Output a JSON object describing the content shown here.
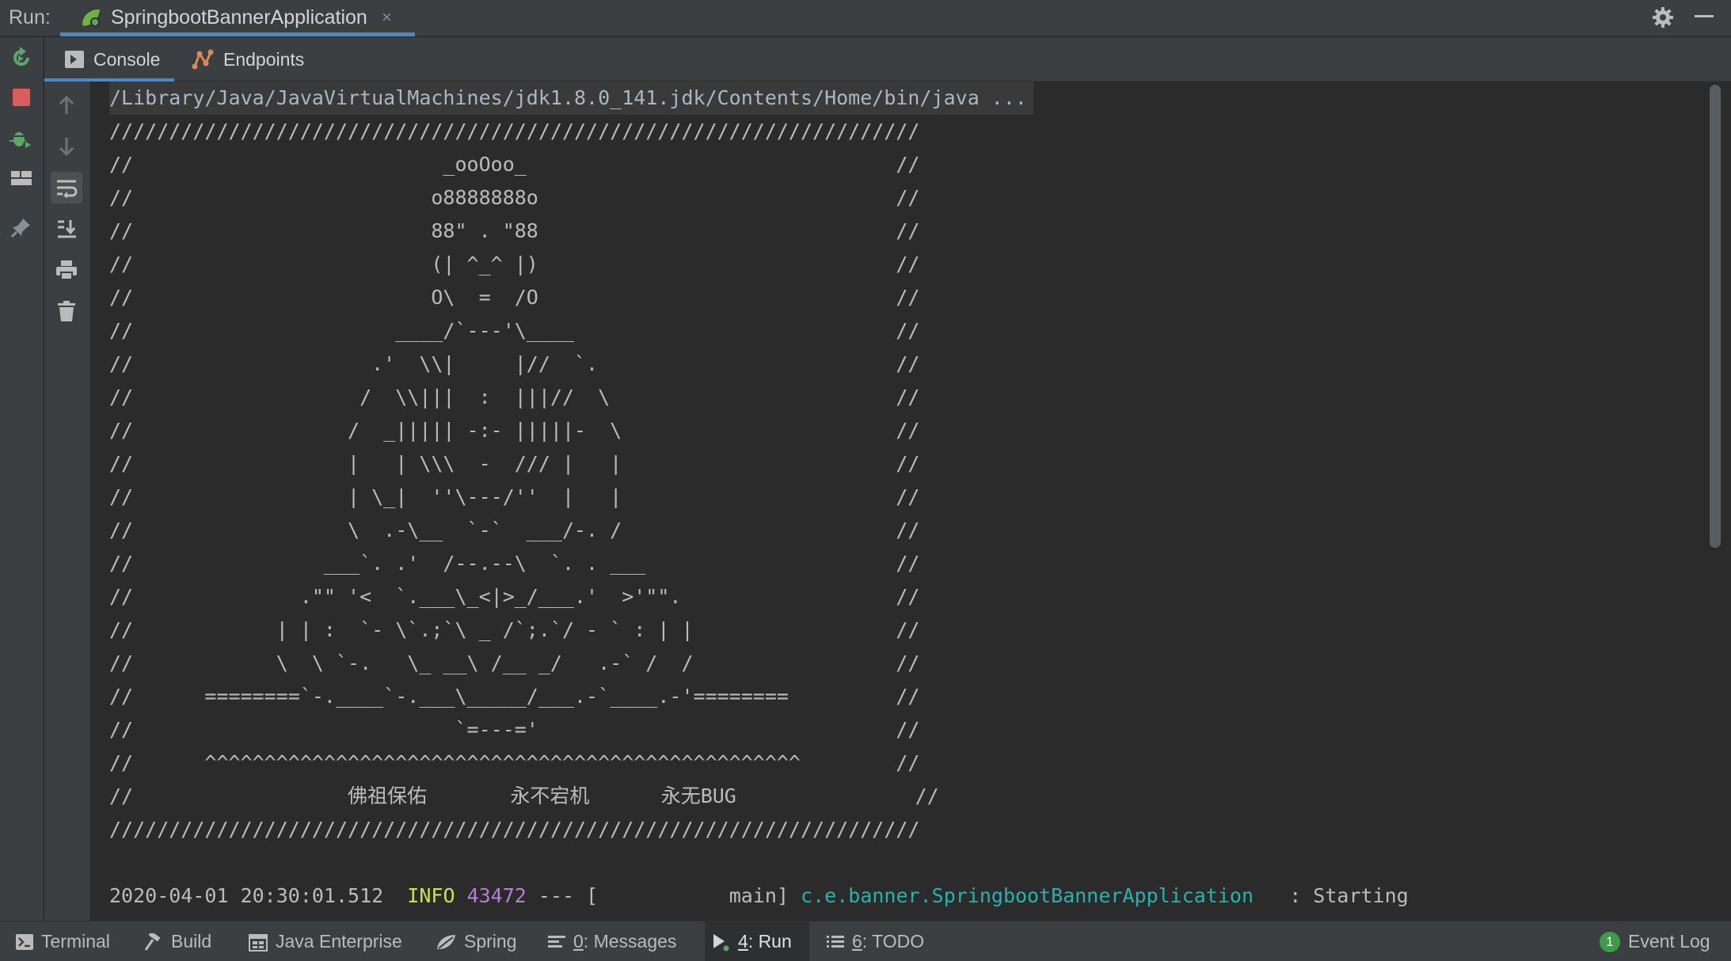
{
  "run_bar": {
    "label": "Run:",
    "tab_title": "SpringbootBannerApplication",
    "tab_close": "×"
  },
  "subtabs": [
    {
      "label": "Console",
      "active": true
    },
    {
      "label": "Endpoints",
      "active": false
    }
  ],
  "console": {
    "command": "/Library/Java/JavaVirtualMachines/jdk1.8.0_141.jdk/Contents/Home/bin/java ...",
    "banner": [
      "////////////////////////////////////////////////////////////////////",
      "//                          _ooOoo_                               //",
      "//                         o8888888o                              //",
      "//                         88\" . \"88                              //",
      "//                         (| ^_^ |)                              //",
      "//                         O\\  =  /O                              //",
      "//                      ____/`---'\\____                           //",
      "//                    .'  \\\\|     |//  `.                         //",
      "//                   /  \\\\|||  :  |||//  \\                        //",
      "//                  /  _||||| -:- |||||-  \\                       //",
      "//                  |   | \\\\\\  -  /// |   |                       //",
      "//                  | \\_|  ''\\---/''  |   |                       //",
      "//                  \\  .-\\__  `-`  ___/-. /                       //",
      "//                ___`. .'  /--.--\\  `. . ___                     //",
      "//              .\"\" '<  `.___\\_<|>_/___.'  >'\"\".                  //",
      "//            | | :  `- \\`.;`\\ _ /`;.`/ - ` : | |                 //",
      "//            \\  \\ `-.   \\_ __\\ /__ _/   .-` /  /                 //",
      "//      ========`-.____`-.___\\_____/___.-`____.-'========         //",
      "//                           `=---='                              //",
      "//      ^^^^^^^^^^^^^^^^^^^^^^^^^^^^^^^^^^^^^^^^^^^^^^^^^^        //",
      "//                  佛祖保佑       永不宕机      永无BUG               //",
      "////////////////////////////////////////////////////////////////////"
    ],
    "log": {
      "timestamp": "2020-04-01 20:30:01.512",
      "level": "INFO",
      "pid": "43472",
      "separator": "--- [",
      "thread": "main]",
      "logger": "c.e.banner.SpringbootBannerApplication",
      "message": ": Starting"
    }
  },
  "left_toolbar": [
    {
      "icon": "rerun-icon",
      "color": "#59a869"
    },
    {
      "icon": "stop-icon",
      "color": "#db5c5c"
    },
    {
      "icon": "debug-restart-icon",
      "color": "#59a869"
    },
    {
      "icon": "layout-icon"
    },
    {
      "icon": "pin-icon"
    }
  ],
  "console_toolbar": [
    {
      "icon": "scroll-up-icon"
    },
    {
      "icon": "scroll-down-icon"
    },
    {
      "icon": "soft-wrap-icon",
      "selected": true
    },
    {
      "icon": "scroll-to-end-icon"
    },
    {
      "icon": "print-icon"
    },
    {
      "icon": "clear-icon"
    }
  ],
  "bottom_tabs": [
    {
      "label": "Terminal",
      "icon": "terminal-icon"
    },
    {
      "label": "Build",
      "icon": "hammer-icon"
    },
    {
      "label": "Java Enterprise",
      "icon": "java-enterprise-icon"
    },
    {
      "label": "Spring",
      "icon": "spring-icon"
    },
    {
      "prefix": "0",
      "label": ": Messages",
      "icon": "messages-icon"
    },
    {
      "prefix": "4",
      "label": ": Run",
      "icon": "run-icon",
      "active": true
    },
    {
      "prefix": "6",
      "label": ": TODO",
      "icon": "todo-icon"
    }
  ],
  "event_log": {
    "label": "Event Log",
    "count": "1"
  },
  "colors": {
    "panel": "#3c3f41",
    "editor": "#2b2b2b",
    "accent": "#4a88c7",
    "info": "#cbe34a",
    "pid": "#b57fd3",
    "logger": "#26b3b0"
  }
}
